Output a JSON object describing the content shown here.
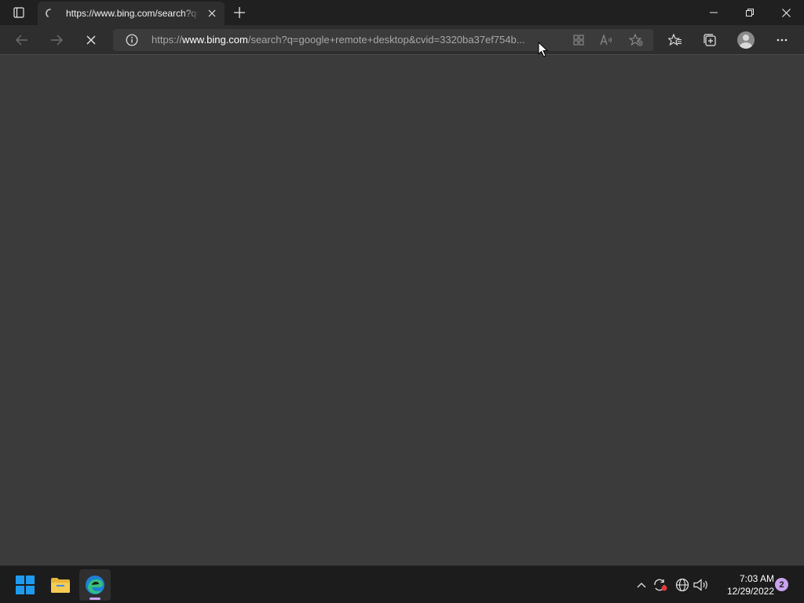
{
  "browser": {
    "tab": {
      "title": "https://www.bing.com/search?q=google+remote+desktop&cvid=3320ba37ef754b"
    },
    "address_bar": {
      "prefix": "https://",
      "host": "www.bing.com",
      "path": "/search?q=google+remote+desktop&cvid=3320ba37ef754b..."
    },
    "state": "loading"
  },
  "taskbar": {
    "clock": {
      "time": "7:03 AM",
      "date": "12/29/2022"
    },
    "notification_count": "2"
  },
  "colors": {
    "accent": "#c8a2f0",
    "windows_blue": "#1e9bf0"
  }
}
